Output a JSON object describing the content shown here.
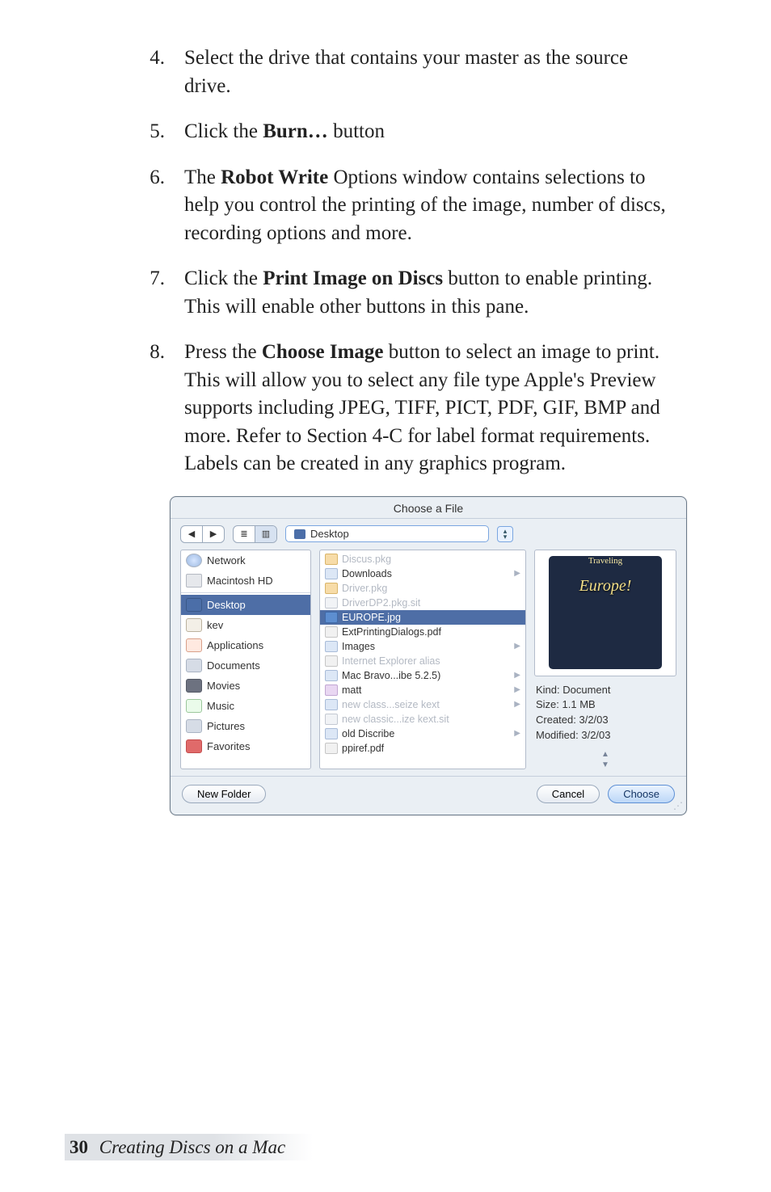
{
  "steps": [
    {
      "num": "4.",
      "text": "Select the drive that contains your master as the source drive."
    },
    {
      "num": "5.",
      "pre": "Click the ",
      "bold": "Burn…",
      "post": " button"
    },
    {
      "num": "6.",
      "pre": "The ",
      "bold": "Robot Write",
      "post": " Options window contains selections to help you control the printing of the image, number of discs, recording options and more."
    },
    {
      "num": "7.",
      "pre": "Click the ",
      "bold": "Print Image on Discs",
      "post": " button to enable printing.  This will enable other buttons in this pane."
    },
    {
      "num": "8.",
      "pre": "Press the ",
      "bold": "Choose Image",
      "post": " button to select an image to print. This will allow you to select any file type Apple's Preview supports including JPEG, TIFF, PICT, PDF, GIF, BMP and more.  Refer to Section 4-C for label format requirements. Labels can be created in any graphics program."
    }
  ],
  "dialog": {
    "title": "Choose a File",
    "path_label": "Desktop",
    "sidebar": [
      {
        "label": "Network",
        "icon": "net"
      },
      {
        "label": "Macintosh HD",
        "icon": "disk"
      },
      {
        "sep": true
      },
      {
        "label": "Desktop",
        "icon": "desk",
        "selected": true
      },
      {
        "label": "kev",
        "icon": "home"
      },
      {
        "label": "Applications",
        "icon": "app"
      },
      {
        "label": "Documents",
        "icon": "fold"
      },
      {
        "label": "Movies",
        "icon": "mov"
      },
      {
        "label": "Music",
        "icon": "mus"
      },
      {
        "label": "Pictures",
        "icon": "fold"
      },
      {
        "label": "Favorites",
        "icon": "fav"
      }
    ],
    "files": [
      {
        "label": "Discus.pkg",
        "icon": "pkg",
        "dim": true
      },
      {
        "label": "Downloads",
        "icon": "fold",
        "chev": true
      },
      {
        "label": "Driver.pkg",
        "icon": "pkg",
        "dim": true
      },
      {
        "label": "DriverDP2.pkg.sit",
        "icon": "sit",
        "dim": true
      },
      {
        "label": "EUROPE.jpg",
        "icon": "img",
        "selected": true
      },
      {
        "label": "ExtPrintingDialogs.pdf",
        "icon": "pdf"
      },
      {
        "label": "Images",
        "icon": "fold",
        "chev": true
      },
      {
        "label": "Internet Explorer alias",
        "icon": "ie",
        "dim": true
      },
      {
        "label": "Mac Bravo...ibe 5.2.5)",
        "icon": "fold",
        "chev": true
      },
      {
        "label": "matt",
        "icon": "pic",
        "chev": true
      },
      {
        "label": "new class...seize kext",
        "icon": "fold",
        "chev": true,
        "dim": true
      },
      {
        "label": "new classic...ize kext.sit",
        "icon": "sit",
        "dim": true
      },
      {
        "label": "old Discribe",
        "icon": "fold",
        "chev": true
      },
      {
        "label": "ppiref.pdf",
        "icon": "pdf"
      }
    ],
    "preview": {
      "thumb_line1": "Traveling",
      "thumb_line2": "Europe!",
      "kind": "Kind: Document",
      "size": "Size: 1.1 MB",
      "created": "Created: 3/2/03",
      "modified": "Modified: 3/2/03"
    },
    "buttons": {
      "new_folder": "New Folder",
      "cancel": "Cancel",
      "choose": "Choose"
    }
  },
  "footer": {
    "page": "30",
    "section": "Creating Discs on a Mac"
  }
}
